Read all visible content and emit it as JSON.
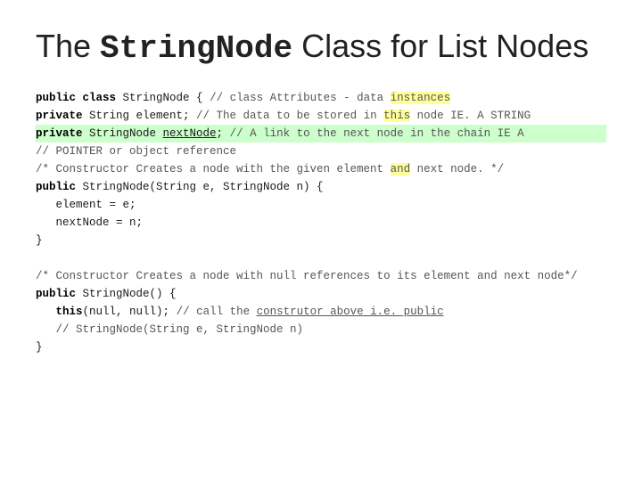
{
  "title": {
    "prefix": "The ",
    "classname": "StringNode",
    "suffix": "  Class for List Nodes"
  },
  "code": {
    "lines": [
      {
        "id": "l1",
        "content": "public class StringNode { // class Attributes - data instances"
      },
      {
        "id": "l2",
        "content": "private String element; // The data to be stored in this node IE. A STRING"
      },
      {
        "id": "l3",
        "content": "private StringNode nextNode; // A link to the next node in the chain IE A"
      },
      {
        "id": "l4",
        "content": "// POINTER or object reference"
      },
      {
        "id": "l5",
        "content": "/* Constructor Creates a node with the given element and next node. */"
      },
      {
        "id": "l6",
        "content": "public StringNode(String e, StringNode n) {"
      },
      {
        "id": "l7",
        "content": "   element = e;"
      },
      {
        "id": "l8",
        "content": "   nextNode = n;"
      },
      {
        "id": "l9",
        "content": "}"
      },
      {
        "id": "l10",
        "content": ""
      },
      {
        "id": "l11",
        "content": "/* Constructor Creates a node with null references to its element and next node*/"
      },
      {
        "id": "l12",
        "content": "public StringNode() {"
      },
      {
        "id": "l13",
        "content": "   this(null, null); // call the construtor above i.e. public"
      },
      {
        "id": "l14",
        "content": "   // StringNode(String e, StringNode n)"
      },
      {
        "id": "l15",
        "content": "}"
      }
    ]
  }
}
